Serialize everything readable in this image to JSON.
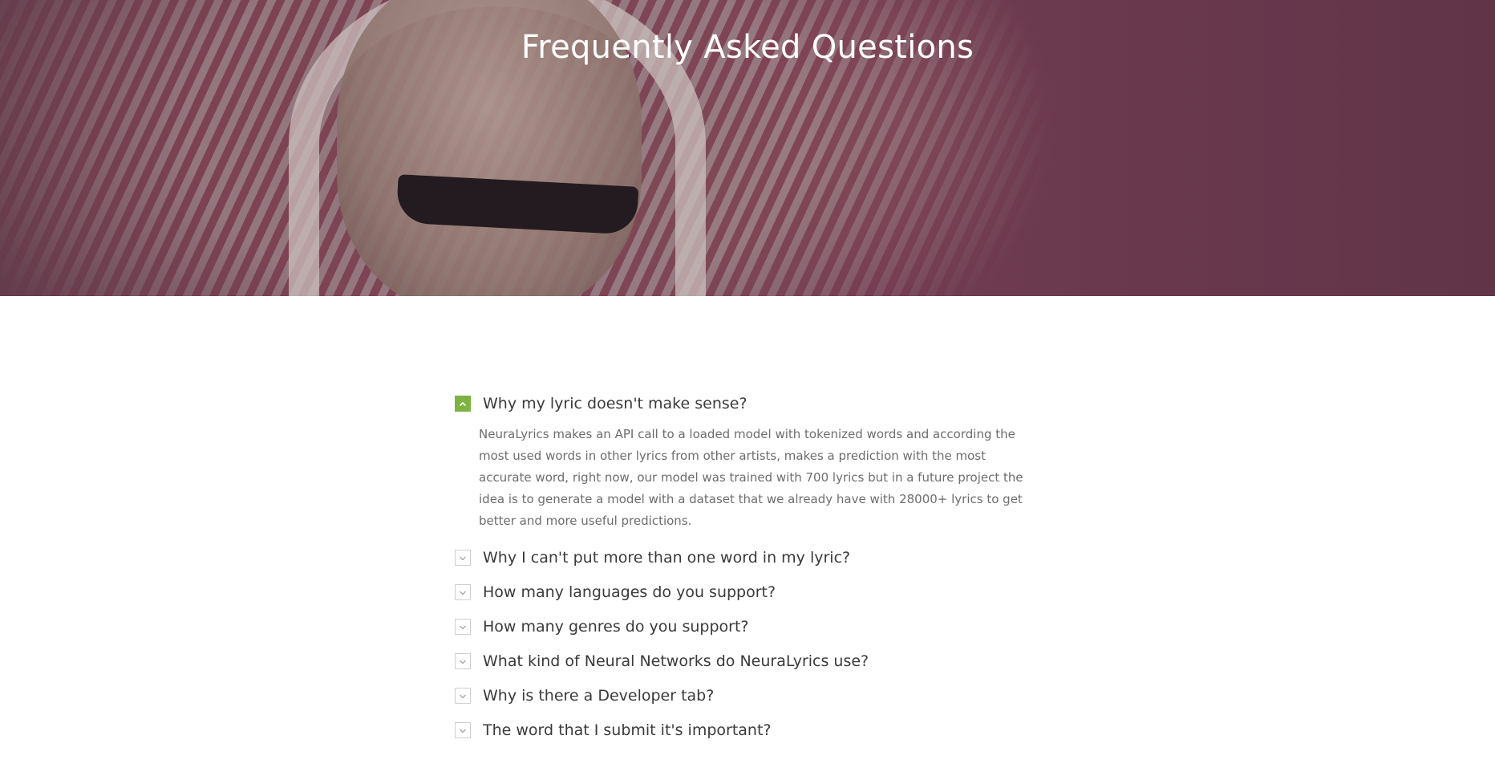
{
  "hero": {
    "title": "Frequently Asked Questions"
  },
  "faq": {
    "items": [
      {
        "question": "Why my lyric doesn't make sense?",
        "expanded": true,
        "answer": "NeuraLyrics makes an API call to a loaded model with tokenized words and according the most used words in other lyrics from other artists, makes a prediction with the most accurate word, right now, our model was trained with 700 lyrics but in a future project the idea is to generate a model with a dataset that we already have with 28000+ lyrics to get better and more useful predictions."
      },
      {
        "question": "Why I can't put more than one word in my lyric?",
        "expanded": false
      },
      {
        "question": "How many languages do you support?",
        "expanded": false
      },
      {
        "question": "How many genres do you support?",
        "expanded": false
      },
      {
        "question": "What kind of Neural Networks do NeuraLyrics use?",
        "expanded": false
      },
      {
        "question": "Why is there a Developer tab?",
        "expanded": false
      },
      {
        "question": "The word that I submit it's important?",
        "expanded": false
      }
    ],
    "icons": {
      "open": "chevron-up-icon",
      "closed": "chevron-down-icon"
    },
    "colors": {
      "accent": "#7cb342",
      "question_text": "#3a3a3a",
      "answer_text": "#6d6d6d"
    }
  }
}
